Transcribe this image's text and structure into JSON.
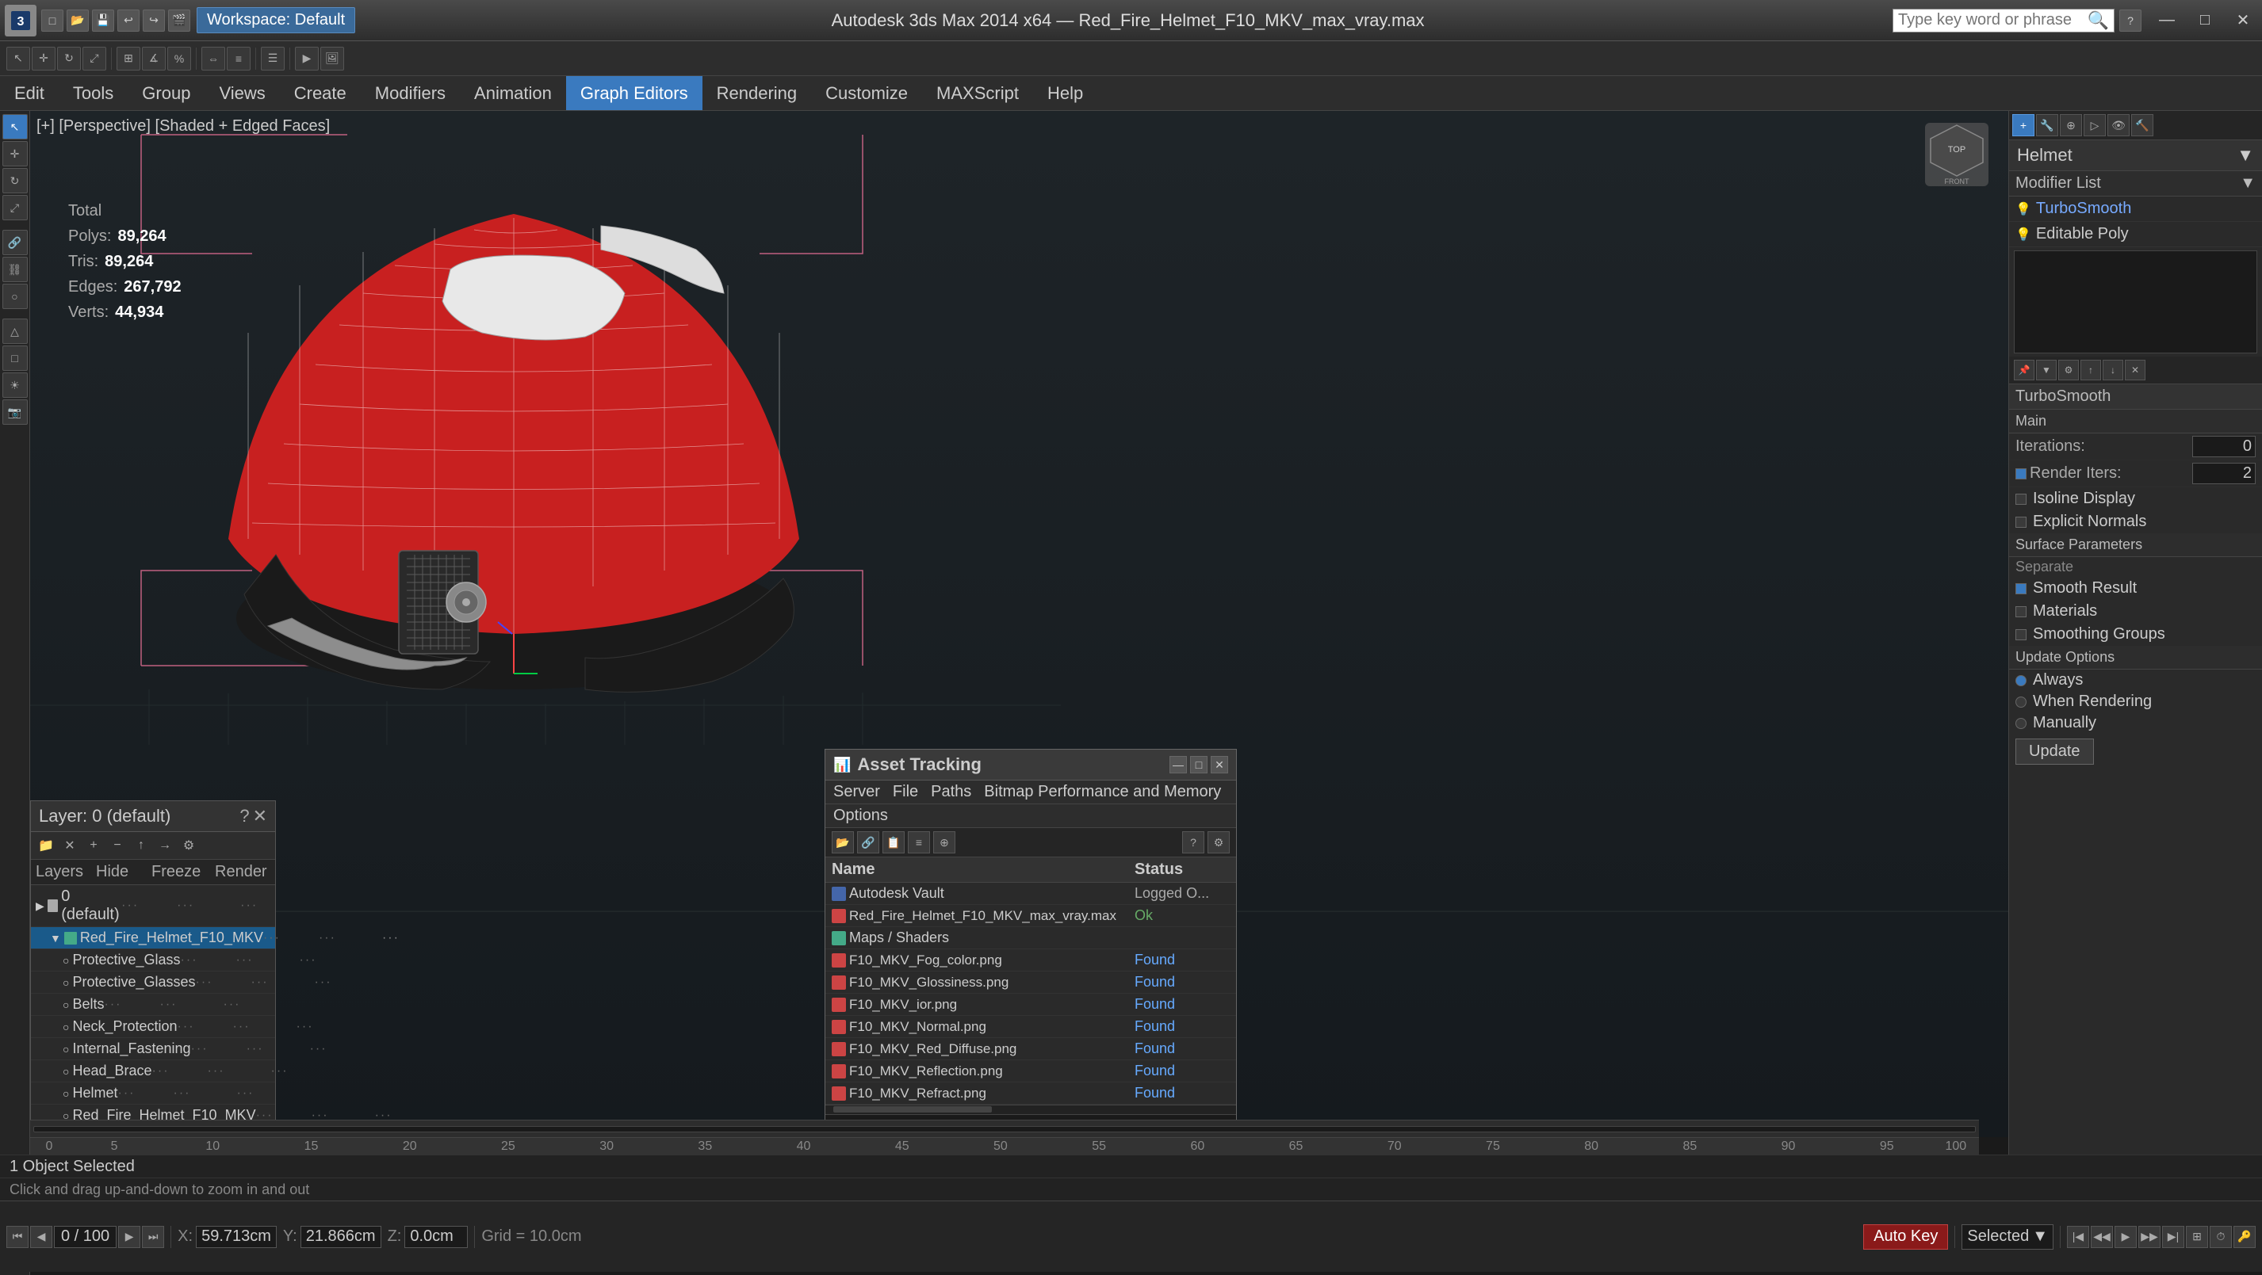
{
  "title_bar": {
    "app_name": "3ds Max",
    "title": "Autodesk 3ds Max 2014 x64 — Red_Fire_Helmet_F10_MKV_max_vray.max",
    "workspace_label": "Workspace: Default",
    "search_placeholder": "Type key word or phrase",
    "minimize": "—",
    "maximize": "□",
    "close": "✕"
  },
  "menu": {
    "items": [
      "Edit",
      "Tools",
      "Group",
      "Views",
      "Create",
      "Modifiers",
      "Animation",
      "Graph Editors",
      "Rendering",
      "Customize",
      "MAXScript",
      "Help"
    ]
  },
  "viewport": {
    "label": "[+] [Perspective] [Shaded + Edged Faces]",
    "stats": {
      "total_label": "Total",
      "polys_label": "Polys:",
      "polys_val": "89,264",
      "tris_label": "Tris:",
      "tris_val": "89,264",
      "edges_label": "Edges:",
      "edges_val": "267,792",
      "verts_label": "Verts:",
      "verts_val": "44,934"
    }
  },
  "layers_panel": {
    "title": "Layer: 0 (default)",
    "columns": [
      "Layers",
      "Hide",
      "Freeze",
      "Render"
    ],
    "items": [
      {
        "name": "0 (default)",
        "level": 0,
        "selected": false,
        "icon": "layer"
      },
      {
        "name": "Red_Fire_Helmet_F10_MKV",
        "level": 1,
        "selected": true,
        "icon": "layer"
      },
      {
        "name": "Protective_Glass",
        "level": 2,
        "selected": false,
        "icon": "object"
      },
      {
        "name": "Protective_Glasses",
        "level": 2,
        "selected": false,
        "icon": "object"
      },
      {
        "name": "Belts",
        "level": 2,
        "selected": false,
        "icon": "object"
      },
      {
        "name": "Neck_Protection",
        "level": 2,
        "selected": false,
        "icon": "object"
      },
      {
        "name": "Internal_Fastening",
        "level": 2,
        "selected": false,
        "icon": "object"
      },
      {
        "name": "Head_Brace",
        "level": 2,
        "selected": false,
        "icon": "object"
      },
      {
        "name": "Helmet",
        "level": 2,
        "selected": false,
        "icon": "object"
      },
      {
        "name": "Red_Fire_Helmet_F10_MKV",
        "level": 2,
        "selected": false,
        "icon": "object"
      }
    ]
  },
  "asset_tracking": {
    "title": "Asset Tracking",
    "menu_items": [
      "Server",
      "File",
      "Paths",
      "Bitmap Performance and Memory",
      "Options"
    ],
    "columns": [
      "Name",
      "Status"
    ],
    "items": [
      {
        "name": "Autodesk Vault",
        "level": 0,
        "status": "Logged O...",
        "icon": "vault"
      },
      {
        "name": "Red_Fire_Helmet_F10_MKV_max_vray.max",
        "level": 1,
        "status": "Ok",
        "icon": "file"
      },
      {
        "name": "Maps / Shaders",
        "level": 2,
        "status": "",
        "icon": "folder"
      },
      {
        "name": "F10_MKV_Fog_color.png",
        "level": 3,
        "status": "Found",
        "icon": "texture"
      },
      {
        "name": "F10_MKV_Glossiness.png",
        "level": 3,
        "status": "Found",
        "icon": "texture"
      },
      {
        "name": "F10_MKV_ior.png",
        "level": 3,
        "status": "Found",
        "icon": "texture"
      },
      {
        "name": "F10_MKV_Normal.png",
        "level": 3,
        "status": "Found",
        "icon": "texture"
      },
      {
        "name": "F10_MKV_Red_Diffuse.png",
        "level": 3,
        "status": "Found",
        "icon": "texture"
      },
      {
        "name": "F10_MKV_Reflection.png",
        "level": 3,
        "status": "Found",
        "icon": "texture"
      },
      {
        "name": "F10_MKV_Refract.png",
        "level": 3,
        "status": "Found",
        "icon": "texture"
      }
    ]
  },
  "right_panel": {
    "object_name": "Helmet",
    "modifier_list_label": "Modifier List",
    "modifiers": [
      {
        "name": "TurboSmooth",
        "active": true
      },
      {
        "name": "Editable Poly",
        "active": false
      }
    ],
    "turbosmooth": {
      "section": "TurboSmooth",
      "main_label": "Main",
      "iterations_label": "Iterations:",
      "iterations_val": "0",
      "render_iters_label": "Render Iters:",
      "render_iters_val": "2",
      "isoline_display": "Isoline Display",
      "explicit_normals": "Explicit Normals",
      "surface_params": "Surface Parameters",
      "separate": "Separate",
      "smooth_result": "Smooth Result",
      "materials": "Materials",
      "smoothing_groups": "Smoothing Groups",
      "update_options": "Update Options",
      "always": "Always",
      "when_rendering": "When Rendering",
      "manually": "Manually",
      "update_btn": "Update"
    }
  },
  "timeline": {
    "frame_label": "0 / 100",
    "ruler_ticks": [
      "0",
      "5",
      "10",
      "15",
      "20",
      "25",
      "30",
      "35",
      "40",
      "45",
      "50",
      "55",
      "60",
      "65",
      "70",
      "75",
      "80",
      "85",
      "90",
      "95",
      "100"
    ]
  },
  "status_bar": {
    "objects_selected": "1 Object Selected",
    "hint": "Click and drag up-and-down to zoom in and out"
  },
  "coord_bar": {
    "x_label": "X:",
    "x_val": "59.713cm",
    "y_label": "Y:",
    "y_val": "21.866cm",
    "z_label": "Z:",
    "z_val": "0.0cm",
    "grid_label": "Grid = 10.0cm",
    "auto_key": "Auto Key",
    "selected_label": "Selected",
    "set_key_label": "Set Key"
  }
}
